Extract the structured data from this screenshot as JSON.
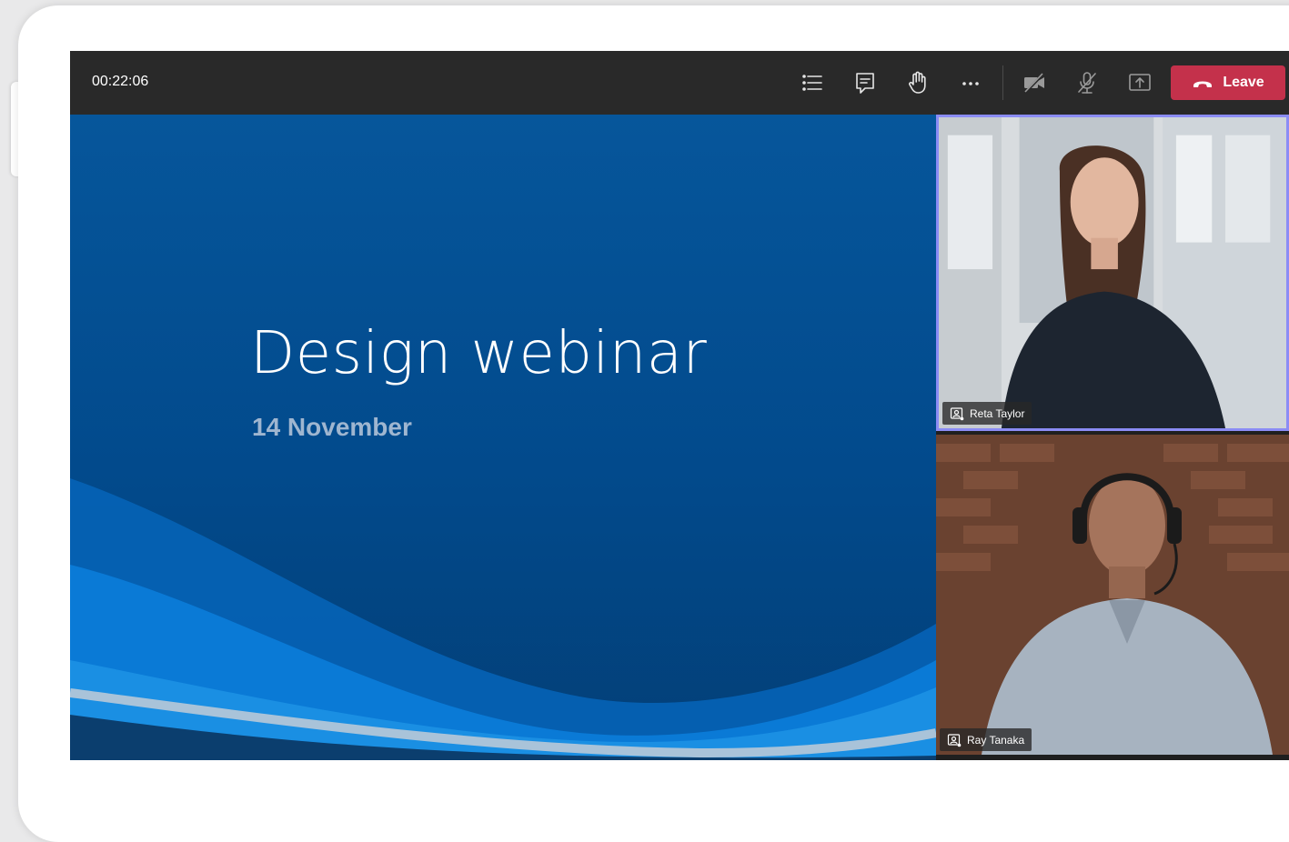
{
  "call": {
    "timer": "00:22:06",
    "leave_label": "Leave"
  },
  "toolbar": {
    "icons": [
      "participants-list-icon",
      "chat-icon",
      "raise-hand-icon",
      "more-options-icon",
      "camera-off-icon",
      "mic-off-icon",
      "share-screen-icon",
      "phone-hangup-icon"
    ]
  },
  "slide": {
    "title": "Design webinar",
    "date": "14 November"
  },
  "participants": [
    {
      "name": "Reta Taylor"
    },
    {
      "name": "Ray Tanaka"
    }
  ],
  "colors": {
    "leave": "#c4314b",
    "active_speaker_border": "#8b8cf5",
    "toolbar": "#292929",
    "slide_bg": "#024a8c"
  }
}
